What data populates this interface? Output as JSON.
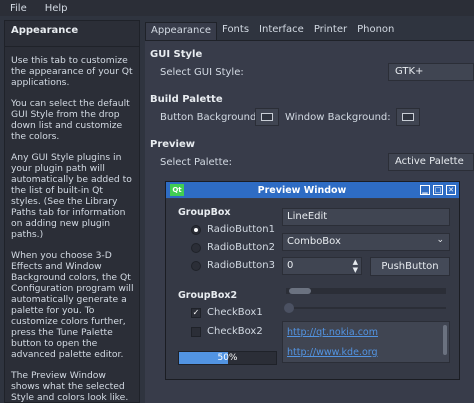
{
  "menu": {
    "file": "File",
    "help": "Help"
  },
  "sidebar": {
    "title": "Appearance",
    "paragraphs": [
      "Use this tab to customize the appearance of your Qt applications.",
      "You can select the default GUI Style from the drop down list and customize the colors.",
      "Any GUI Style plugins in your plugin path will automatically be added to the list of built-in Qt styles. (See the Library Paths tab for information on adding new plugin paths.)",
      "When you choose 3-D Effects and Window Background colors, the Qt Configuration program will automatically generate a palette for you. To customize colors further, press the Tune Palette button to open the advanced palette editor.",
      "The Preview Window shows what the selected Style and colors look like."
    ]
  },
  "tabs": [
    "Appearance",
    "Fonts",
    "Interface",
    "Printer",
    "Phonon"
  ],
  "gui_style": {
    "section": "GUI Style",
    "label": "Select GUI Style:",
    "value": "GTK+"
  },
  "build_palette": {
    "section": "Build Palette",
    "button_bg": "Button Background:",
    "window_bg": "Window Background:"
  },
  "preview": {
    "section": "Preview",
    "palette_label": "Select Palette:",
    "palette_value": "Active Palette",
    "window_title": "Preview Window",
    "qt_logo": "Qt",
    "groupbox1": "GroupBox",
    "radio1": "RadioButton1",
    "radio2": "RadioButton2",
    "radio3": "RadioButton3",
    "lineedit": "LineEdit",
    "combobox": "ComboBox",
    "spin_value": "0",
    "pushbutton": "PushButton",
    "groupbox2": "GroupBox2",
    "check1": "CheckBox1",
    "check2": "CheckBox2",
    "progress_text": "50%",
    "progress_value": 0.5,
    "link1": "http://qt.nokia.com",
    "link2": "http://www.kde.org"
  },
  "colors": {
    "accent": "#5294e2",
    "titlebar": "#2e6cc4",
    "background": "#383c4a"
  },
  "icons": {
    "combo_arrow": "chevron-down-icon",
    "spin_up": "arrow-up-icon",
    "spin_down": "arrow-down-icon"
  }
}
